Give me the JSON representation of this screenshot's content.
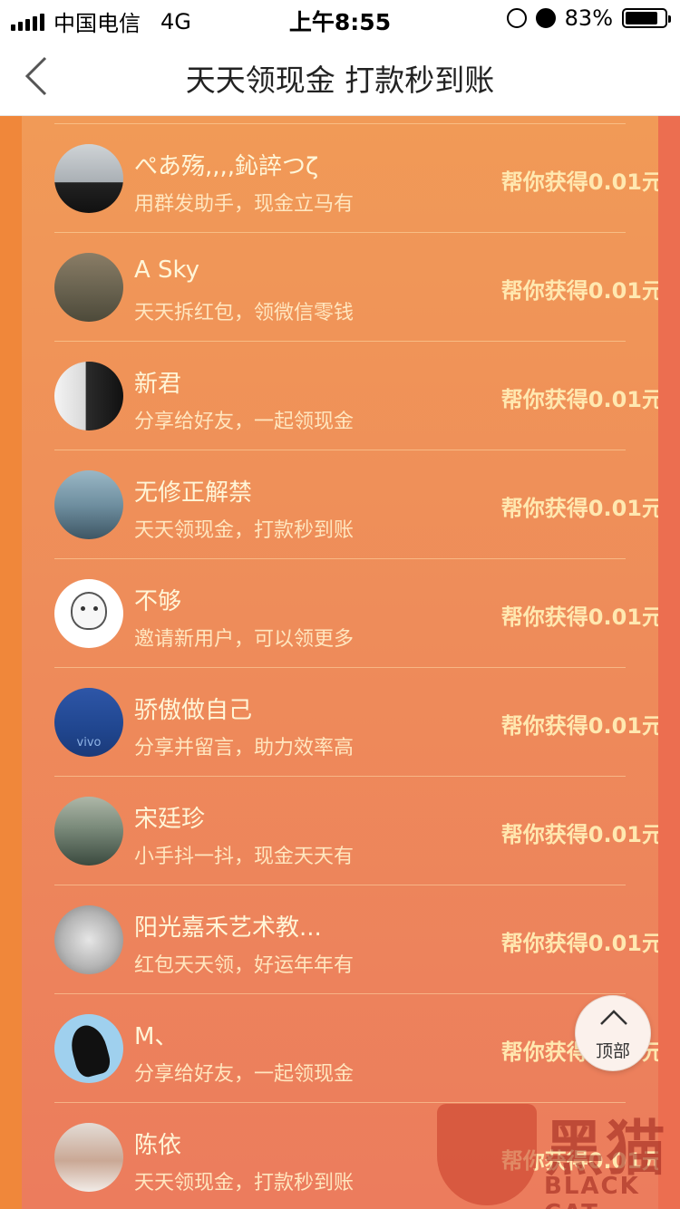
{
  "status_bar": {
    "carrier": "中国电信",
    "network": "4G",
    "time": "上午8:55",
    "battery": "83%",
    "battery_level": 0.83
  },
  "nav": {
    "title": "天天领现金 打款秒到账"
  },
  "reward_text": "帮你获得0.01元",
  "rows": [
    {
      "name": "ぺあ殇,,,,鈊誶つζ",
      "subtitle": "用群发助手，现金立马有",
      "reward": "帮你获得0.01元"
    },
    {
      "name": "A Sky",
      "subtitle": "天天拆红包，领微信零钱",
      "reward": "帮你获得0.01元"
    },
    {
      "name": "新君",
      "subtitle": "分享给好友，一起领现金",
      "reward": "帮你获得0.01元"
    },
    {
      "name": "无修正解禁",
      "subtitle": "天天领现金，打款秒到账",
      "reward": "帮你获得0.01元"
    },
    {
      "name": "不够",
      "subtitle": "邀请新用户，可以领更多",
      "reward": "帮你获得0.01元"
    },
    {
      "name": "骄傲做自己",
      "subtitle": "分享并留言，助力效率高",
      "reward": "帮你获得0.01元"
    },
    {
      "name": "宋廷珍",
      "subtitle": "小手抖一抖，现金天天有",
      "reward": "帮你获得0.01元"
    },
    {
      "name": "阳光嘉禾艺术教...",
      "subtitle": "红包天天领，好运年年有",
      "reward": "帮你获得0.01元"
    },
    {
      "name": "M、",
      "subtitle": "分享给好友，一起领现金",
      "reward": "帮你获得0.01元"
    },
    {
      "name": "陈依",
      "subtitle": "天天领现金，打款秒到账",
      "reward": "帮你获得0.01元"
    }
  ],
  "avatar_labels": {
    "row5": "vivo"
  },
  "top_button": {
    "label": "顶部"
  },
  "watermark": {
    "cn": "黑猫",
    "en": "BLACK CAT"
  }
}
